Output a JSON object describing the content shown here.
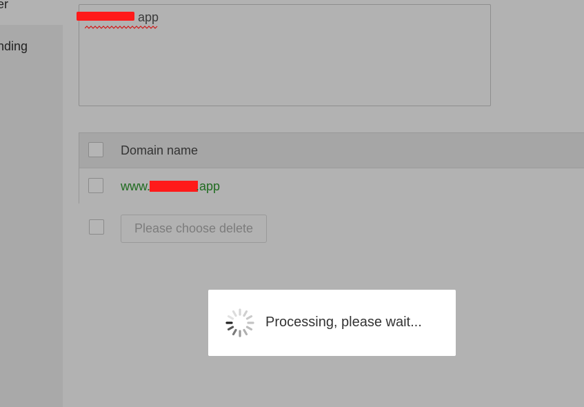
{
  "sidebar": {
    "items": [
      {
        "label": "er"
      },
      {
        "label": "nding"
      }
    ]
  },
  "domain_input": {
    "value": "www.        app",
    "shown_text": "app"
  },
  "domain_table": {
    "header": "Domain name",
    "rows": [
      {
        "prefix": "www.",
        "suffix": ".app"
      }
    ]
  },
  "footer": {
    "delete_label": "Please choose delete"
  },
  "loading": {
    "text": "Processing, please wait..."
  },
  "colors": {
    "overlay": "#b2b2b2",
    "link_green": "#1f6b1f",
    "redaction": "#ff1a1a"
  }
}
